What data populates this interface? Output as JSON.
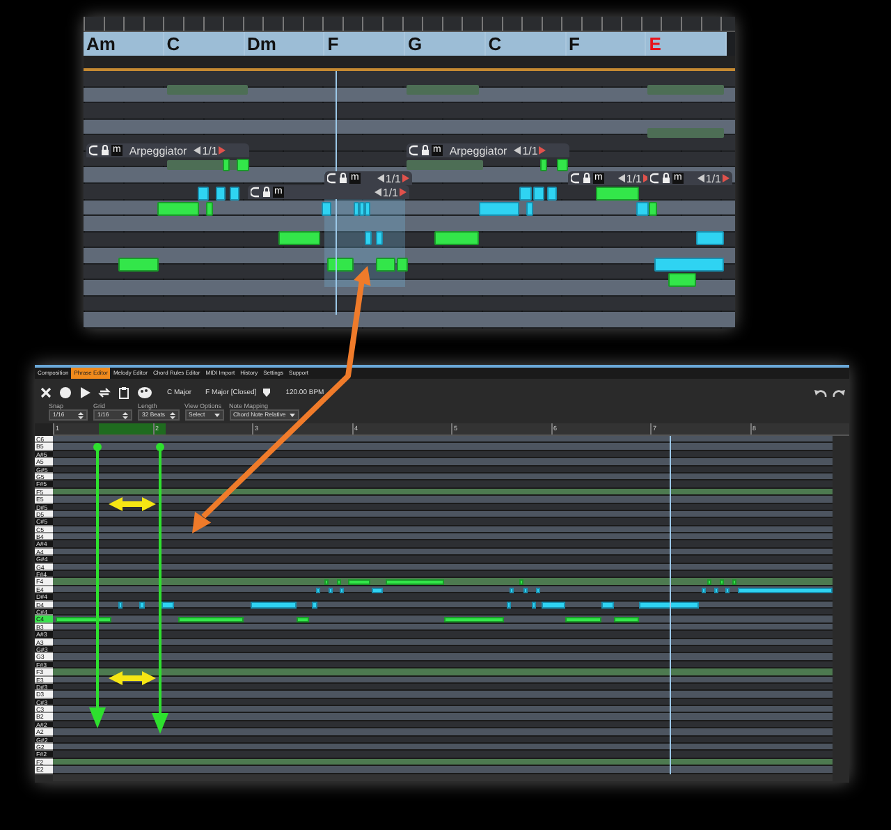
{
  "arrangement_view": {
    "chords": [
      {
        "label": "Am",
        "color": "#111111"
      },
      {
        "label": "C",
        "color": "#111111"
      },
      {
        "label": "Dm",
        "color": "#111111"
      },
      {
        "label": "F",
        "color": "#111111"
      },
      {
        "label": "G",
        "color": "#111111"
      },
      {
        "label": "C",
        "color": "#111111"
      },
      {
        "label": "F",
        "color": "#111111"
      },
      {
        "label": "E",
        "color": "#e8141b"
      }
    ],
    "clips": [
      {
        "mute": "m",
        "title": "Arpeggiator",
        "counter": "1/1"
      },
      {
        "mute": "m",
        "title": "Arpeggiator",
        "counter": "1/1"
      },
      {
        "mute": "m",
        "counter": "1/1"
      },
      {
        "mute": "m",
        "counter": "1/1"
      },
      {
        "mute": "m",
        "counter": "1/1"
      },
      {
        "mute": "m",
        "counter": "1/1"
      }
    ]
  },
  "phrase_editor": {
    "tabs": [
      {
        "label": "Composition",
        "selected": false
      },
      {
        "label": "Phrase Editor",
        "selected": true
      },
      {
        "label": "Melody Editor",
        "selected": false
      },
      {
        "label": "Chord Rules Editor",
        "selected": false
      },
      {
        "label": "MIDI Import",
        "selected": false
      },
      {
        "label": "History",
        "selected": false
      },
      {
        "label": "Settings",
        "selected": false
      },
      {
        "label": "Support",
        "selected": false
      }
    ],
    "toolbar": {
      "scale": "C Major",
      "chord": "F Major [Closed]",
      "tempo": "120.00 BPM"
    },
    "fields": [
      {
        "kind": "spin",
        "label": "Snap",
        "value": "1/16"
      },
      {
        "kind": "spin",
        "label": "Grid",
        "value": "1/16"
      },
      {
        "kind": "spin",
        "label": "Length",
        "value": "32 Beats"
      },
      {
        "kind": "select",
        "label": "View Options",
        "value": "Select"
      },
      {
        "kind": "select",
        "label": "Note Mapping",
        "value": "Chord Note Relative"
      }
    ],
    "ruler": [
      "1",
      "2",
      "3",
      "4",
      "5",
      "6",
      "7",
      "8"
    ],
    "keys": [
      {
        "label": "C6",
        "kind": "white",
        "selected": false
      },
      {
        "label": "B5",
        "kind": "white",
        "selected": false
      },
      {
        "label": "A#5",
        "kind": "black",
        "selected": false
      },
      {
        "label": "A5",
        "kind": "white",
        "selected": false
      },
      {
        "label": "G#5",
        "kind": "black",
        "selected": false
      },
      {
        "label": "G5",
        "kind": "white",
        "selected": false
      },
      {
        "label": "F#5",
        "kind": "black",
        "selected": false
      },
      {
        "label": "F5",
        "kind": "white",
        "selected": false
      },
      {
        "label": "E5",
        "kind": "white",
        "selected": false
      },
      {
        "label": "D#5",
        "kind": "black",
        "selected": false
      },
      {
        "label": "D5",
        "kind": "white",
        "selected": false
      },
      {
        "label": "C#5",
        "kind": "black",
        "selected": false
      },
      {
        "label": "C5",
        "kind": "white",
        "selected": false
      },
      {
        "label": "B4",
        "kind": "white",
        "selected": false
      },
      {
        "label": "A#4",
        "kind": "black",
        "selected": false
      },
      {
        "label": "A4",
        "kind": "white",
        "selected": false
      },
      {
        "label": "G#4",
        "kind": "black",
        "selected": false
      },
      {
        "label": "G4",
        "kind": "white",
        "selected": false
      },
      {
        "label": "F#4",
        "kind": "black",
        "selected": false
      },
      {
        "label": "F4",
        "kind": "white",
        "selected": false
      },
      {
        "label": "E4",
        "kind": "white",
        "selected": false
      },
      {
        "label": "D#4",
        "kind": "black",
        "selected": false
      },
      {
        "label": "D4",
        "kind": "white",
        "selected": false
      },
      {
        "label": "C#4",
        "kind": "black",
        "selected": false
      },
      {
        "label": "C4",
        "kind": "white",
        "selected": true
      },
      {
        "label": "B3",
        "kind": "white",
        "selected": false
      },
      {
        "label": "A#3",
        "kind": "black",
        "selected": false
      },
      {
        "label": "A3",
        "kind": "white",
        "selected": false
      },
      {
        "label": "G#3",
        "kind": "black",
        "selected": false
      },
      {
        "label": "G3",
        "kind": "white",
        "selected": false
      },
      {
        "label": "F#3",
        "kind": "black",
        "selected": false
      },
      {
        "label": "F3",
        "kind": "white",
        "selected": false
      },
      {
        "label": "E3",
        "kind": "white",
        "selected": false
      },
      {
        "label": "D#3",
        "kind": "black",
        "selected": false
      },
      {
        "label": "D3",
        "kind": "white",
        "selected": false
      },
      {
        "label": "C#3",
        "kind": "black",
        "selected": false
      },
      {
        "label": "C3",
        "kind": "white",
        "selected": false
      },
      {
        "label": "B2",
        "kind": "white",
        "selected": false
      },
      {
        "label": "A#2",
        "kind": "black",
        "selected": false
      },
      {
        "label": "A2",
        "kind": "white",
        "selected": false
      },
      {
        "label": "G#2",
        "kind": "black",
        "selected": false
      },
      {
        "label": "G2",
        "kind": "white",
        "selected": false
      },
      {
        "label": "F#2",
        "kind": "black",
        "selected": false
      },
      {
        "label": "F2",
        "kind": "white",
        "selected": false
      },
      {
        "label": "E2",
        "kind": "white",
        "selected": false
      }
    ]
  }
}
